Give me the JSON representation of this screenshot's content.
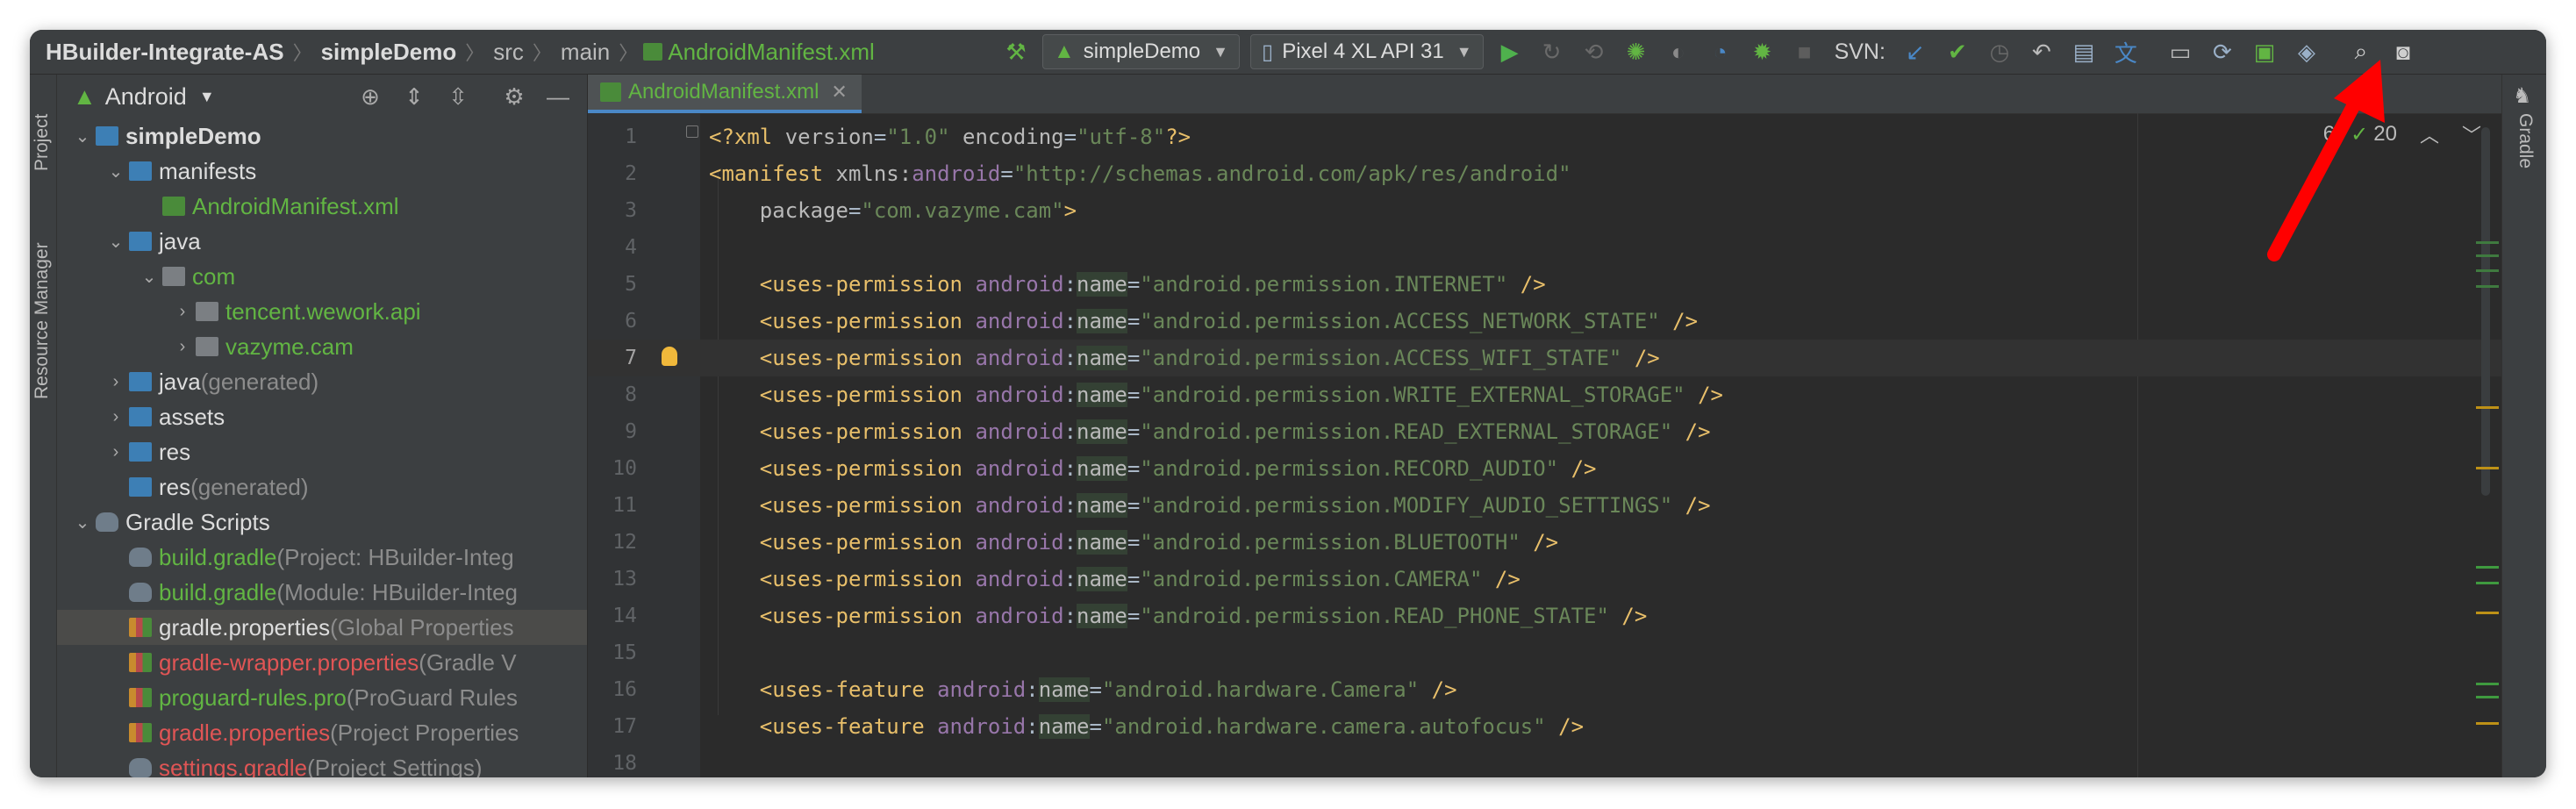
{
  "breadcrumbs": [
    "HBuilder-Integrate-AS",
    "simpleDemo",
    "src",
    "main",
    "AndroidManifest.xml"
  ],
  "toolbar": {
    "run_config": "simpleDemo",
    "device": "Pixel 4 XL API 31",
    "svn_label": "SVN:"
  },
  "left_strip": {
    "project_label": "Project",
    "resource_manager_label": "Resource Manager"
  },
  "right_strip": {
    "gradle_label": "Gradle"
  },
  "project_panel": {
    "view_mode": "Android",
    "tree": [
      {
        "label": "simpleDemo",
        "suffix": "",
        "depth": 0,
        "arrow": "v",
        "icon": "module-folder",
        "style": "bold"
      },
      {
        "label": "manifests",
        "suffix": "",
        "depth": 1,
        "arrow": "v",
        "icon": "folder",
        "style": "normal"
      },
      {
        "label": "AndroidManifest.xml",
        "suffix": "",
        "depth": 2,
        "arrow": "",
        "icon": "xml-file",
        "style": "green"
      },
      {
        "label": "java",
        "suffix": "",
        "depth": 1,
        "arrow": "v",
        "icon": "folder",
        "style": "normal"
      },
      {
        "label": "com",
        "suffix": "",
        "depth": 2,
        "arrow": "v",
        "icon": "package",
        "style": "green"
      },
      {
        "label": "tencent.wework.api",
        "suffix": "",
        "depth": 3,
        "arrow": ">",
        "icon": "package",
        "style": "green"
      },
      {
        "label": "vazyme.cam",
        "suffix": "",
        "depth": 3,
        "arrow": ">",
        "icon": "package",
        "style": "green"
      },
      {
        "label": "java",
        "suffix": " (generated)",
        "depth": 1,
        "arrow": ">",
        "icon": "folder",
        "style": "normal"
      },
      {
        "label": "assets",
        "suffix": "",
        "depth": 1,
        "arrow": ">",
        "icon": "folder",
        "style": "normal"
      },
      {
        "label": "res",
        "suffix": "",
        "depth": 1,
        "arrow": ">",
        "icon": "folder",
        "style": "normal"
      },
      {
        "label": "res",
        "suffix": " (generated)",
        "depth": 1,
        "arrow": "",
        "icon": "folder",
        "style": "normal"
      },
      {
        "label": "Gradle Scripts",
        "suffix": "",
        "depth": 0,
        "arrow": "v",
        "icon": "gradle",
        "style": "normal"
      },
      {
        "label": "build.gradle",
        "suffix": " (Project: HBuilder-Integ",
        "depth": 1,
        "arrow": "",
        "icon": "gradle",
        "style": "green"
      },
      {
        "label": "build.gradle",
        "suffix": " (Module: HBuilder-Integ",
        "depth": 1,
        "arrow": "",
        "icon": "gradle",
        "style": "green"
      },
      {
        "label": "gradle.properties",
        "suffix": " (Global Properties",
        "depth": 1,
        "arrow": "",
        "icon": "properties",
        "style": "normal",
        "selected": true
      },
      {
        "label": "gradle-wrapper.properties",
        "suffix": " (Gradle V",
        "depth": 1,
        "arrow": "",
        "icon": "properties",
        "style": "red"
      },
      {
        "label": "proguard-rules.pro",
        "suffix": " (ProGuard Rules",
        "depth": 1,
        "arrow": "",
        "icon": "properties",
        "style": "green"
      },
      {
        "label": "gradle.properties",
        "suffix": " (Project Properties",
        "depth": 1,
        "arrow": "",
        "icon": "properties",
        "style": "red"
      },
      {
        "label": "settings.gradle",
        "suffix": " (Project Settings)",
        "depth": 1,
        "arrow": "",
        "icon": "gradle",
        "style": "red"
      }
    ]
  },
  "editor": {
    "tab_label": "AndroidManifest.xml",
    "inspections": {
      "warnings": "6",
      "ok_count": "20"
    },
    "caret_line": 7,
    "lines": [
      {
        "n": "1",
        "segs": [
          [
            "t-tag",
            "<?xml "
          ],
          [
            "t-attr",
            "version"
          ],
          [
            "t-punct",
            "="
          ],
          [
            "t-val",
            "\"1.0\""
          ],
          [
            "t-punct",
            " "
          ],
          [
            "t-attr",
            "encoding"
          ],
          [
            "t-punct",
            "="
          ],
          [
            "t-val",
            "\"utf-8\""
          ],
          [
            "t-tag",
            "?>"
          ]
        ]
      },
      {
        "n": "2",
        "segs": [
          [
            "t-tag",
            "<manifest "
          ],
          [
            "t-attr",
            "xmlns:"
          ],
          [
            "t-ns",
            "android"
          ],
          [
            "t-punct",
            "="
          ],
          [
            "t-val",
            "\"http://schemas.android.com/apk/res/android\""
          ]
        ]
      },
      {
        "n": "3",
        "segs": [
          [
            "t-punct",
            "    "
          ],
          [
            "t-attr",
            "package"
          ],
          [
            "t-punct",
            "="
          ],
          [
            "t-val",
            "\"com.vazyme.cam\""
          ],
          [
            "t-tag",
            ">"
          ]
        ]
      },
      {
        "n": "4",
        "segs": []
      },
      {
        "n": "5",
        "segs": [
          [
            "t-punct",
            "    "
          ],
          [
            "t-tag",
            "<uses-permission "
          ],
          [
            "t-ns",
            "android"
          ],
          [
            "t-punct",
            ":"
          ],
          [
            "t-attr",
            "name"
          ],
          [
            "t-punct",
            "="
          ],
          [
            "t-val",
            "\"android.permission.INTERNET\""
          ],
          [
            "t-punct",
            " "
          ],
          [
            "t-tag",
            "/>"
          ]
        ]
      },
      {
        "n": "6",
        "segs": [
          [
            "t-punct",
            "    "
          ],
          [
            "t-tag",
            "<uses-permission "
          ],
          [
            "t-ns",
            "android"
          ],
          [
            "t-punct",
            ":"
          ],
          [
            "t-attr",
            "name"
          ],
          [
            "t-punct",
            "="
          ],
          [
            "t-val",
            "\"android.permission.ACCESS_NETWORK_STATE\""
          ],
          [
            "t-punct",
            " "
          ],
          [
            "t-tag",
            "/>"
          ]
        ]
      },
      {
        "n": "7",
        "segs": [
          [
            "t-punct",
            "    "
          ],
          [
            "t-tag",
            "<uses-permission "
          ],
          [
            "t-ns",
            "android"
          ],
          [
            "t-punct",
            ":"
          ],
          [
            "t-attr",
            "name"
          ],
          [
            "t-punct",
            "="
          ],
          [
            "t-val",
            "\"android.permission.ACCESS_WIFI_STATE\""
          ],
          [
            "t-punct",
            " "
          ],
          [
            "t-tag",
            "/>"
          ]
        ]
      },
      {
        "n": "8",
        "segs": [
          [
            "t-punct",
            "    "
          ],
          [
            "t-tag",
            "<uses-permission "
          ],
          [
            "t-ns",
            "android"
          ],
          [
            "t-punct",
            ":"
          ],
          [
            "t-attr",
            "name"
          ],
          [
            "t-punct",
            "="
          ],
          [
            "t-val",
            "\"android.permission.WRITE_EXTERNAL_STORAGE\""
          ],
          [
            "t-punct",
            " "
          ],
          [
            "t-tag",
            "/>"
          ]
        ]
      },
      {
        "n": "9",
        "segs": [
          [
            "t-punct",
            "    "
          ],
          [
            "t-tag",
            "<uses-permission "
          ],
          [
            "t-ns",
            "android"
          ],
          [
            "t-punct",
            ":"
          ],
          [
            "t-attr",
            "name"
          ],
          [
            "t-punct",
            "="
          ],
          [
            "t-val",
            "\"android.permission.READ_EXTERNAL_STORAGE\""
          ],
          [
            "t-punct",
            " "
          ],
          [
            "t-tag",
            "/>"
          ]
        ]
      },
      {
        "n": "10",
        "segs": [
          [
            "t-punct",
            "    "
          ],
          [
            "t-tag",
            "<uses-permission "
          ],
          [
            "t-ns",
            "android"
          ],
          [
            "t-punct",
            ":"
          ],
          [
            "t-attr",
            "name"
          ],
          [
            "t-punct",
            "="
          ],
          [
            "t-val",
            "\"android.permission.RECORD_AUDIO\""
          ],
          [
            "t-punct",
            " "
          ],
          [
            "t-tag",
            "/>"
          ]
        ]
      },
      {
        "n": "11",
        "segs": [
          [
            "t-punct",
            "    "
          ],
          [
            "t-tag",
            "<uses-permission "
          ],
          [
            "t-ns",
            "android"
          ],
          [
            "t-punct",
            ":"
          ],
          [
            "t-attr",
            "name"
          ],
          [
            "t-punct",
            "="
          ],
          [
            "t-val",
            "\"android.permission.MODIFY_AUDIO_SETTINGS\""
          ],
          [
            "t-punct",
            " "
          ],
          [
            "t-tag",
            "/>"
          ]
        ]
      },
      {
        "n": "12",
        "segs": [
          [
            "t-punct",
            "    "
          ],
          [
            "t-tag",
            "<uses-permission "
          ],
          [
            "t-ns",
            "android"
          ],
          [
            "t-punct",
            ":"
          ],
          [
            "t-attr",
            "name"
          ],
          [
            "t-punct",
            "="
          ],
          [
            "t-val",
            "\"android.permission.BLUETOOTH\""
          ],
          [
            "t-punct",
            " "
          ],
          [
            "t-tag",
            "/>"
          ]
        ]
      },
      {
        "n": "13",
        "segs": [
          [
            "t-punct",
            "    "
          ],
          [
            "t-tag",
            "<uses-permission "
          ],
          [
            "t-ns",
            "android"
          ],
          [
            "t-punct",
            ":"
          ],
          [
            "t-attr",
            "name"
          ],
          [
            "t-punct",
            "="
          ],
          [
            "t-val",
            "\"android.permission.CAMERA\""
          ],
          [
            "t-punct",
            " "
          ],
          [
            "t-tag",
            "/>"
          ]
        ]
      },
      {
        "n": "14",
        "segs": [
          [
            "t-punct",
            "    "
          ],
          [
            "t-tag",
            "<uses-permission "
          ],
          [
            "t-ns",
            "android"
          ],
          [
            "t-punct",
            ":"
          ],
          [
            "t-attr",
            "name"
          ],
          [
            "t-punct",
            "="
          ],
          [
            "t-val",
            "\"android.permission.READ_PHONE_STATE\""
          ],
          [
            "t-punct",
            " "
          ],
          [
            "t-tag",
            "/>"
          ]
        ]
      },
      {
        "n": "15",
        "segs": []
      },
      {
        "n": "16",
        "segs": [
          [
            "t-punct",
            "    "
          ],
          [
            "t-tag",
            "<uses-feature "
          ],
          [
            "t-ns",
            "android"
          ],
          [
            "t-punct",
            ":"
          ],
          [
            "t-attr",
            "name"
          ],
          [
            "t-punct",
            "="
          ],
          [
            "t-val",
            "\"android.hardware.Camera\""
          ],
          [
            "t-punct",
            " "
          ],
          [
            "t-tag",
            "/>"
          ]
        ]
      },
      {
        "n": "17",
        "segs": [
          [
            "t-punct",
            "    "
          ],
          [
            "t-tag",
            "<uses-feature "
          ],
          [
            "t-ns",
            "android"
          ],
          [
            "t-punct",
            ":"
          ],
          [
            "t-attr",
            "name"
          ],
          [
            "t-punct",
            "="
          ],
          [
            "t-val",
            "\"android.hardware.camera.autofocus\""
          ],
          [
            "t-punct",
            " "
          ],
          [
            "t-tag",
            "/>"
          ]
        ]
      },
      {
        "n": "18",
        "segs": []
      }
    ]
  },
  "colors": {
    "accent_green": "#62b543",
    "error_red": "#e05555",
    "annotation_red": "#ff0000",
    "tab_underline": "#4a88c7"
  }
}
